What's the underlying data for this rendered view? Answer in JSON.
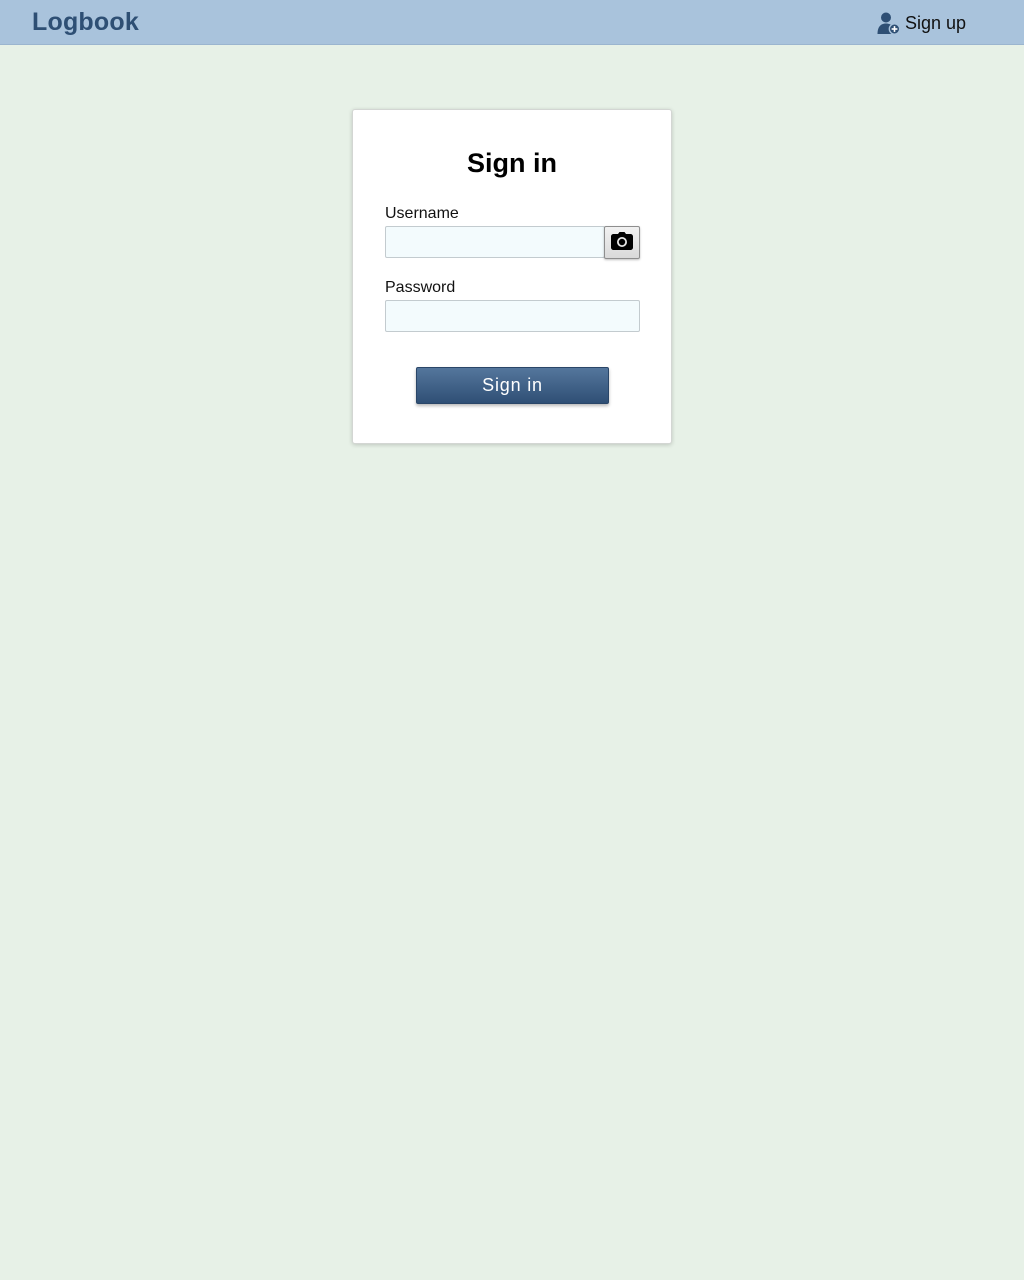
{
  "header": {
    "brand": "Logbook",
    "signup_label": "Sign up",
    "signup_icon": "add-user-icon",
    "background_color": "#a9c3dc",
    "brand_color": "#2e4f74"
  },
  "form": {
    "title": "Sign in",
    "username_label": "Username",
    "username_value": "",
    "username_placeholder": "",
    "camera_icon": "camera-icon",
    "password_label": "Password",
    "password_value": "",
    "password_placeholder": "",
    "submit_label": "Sign in",
    "submit_color": "#3f6088"
  },
  "page": {
    "background_color": "#e7f1e7"
  }
}
